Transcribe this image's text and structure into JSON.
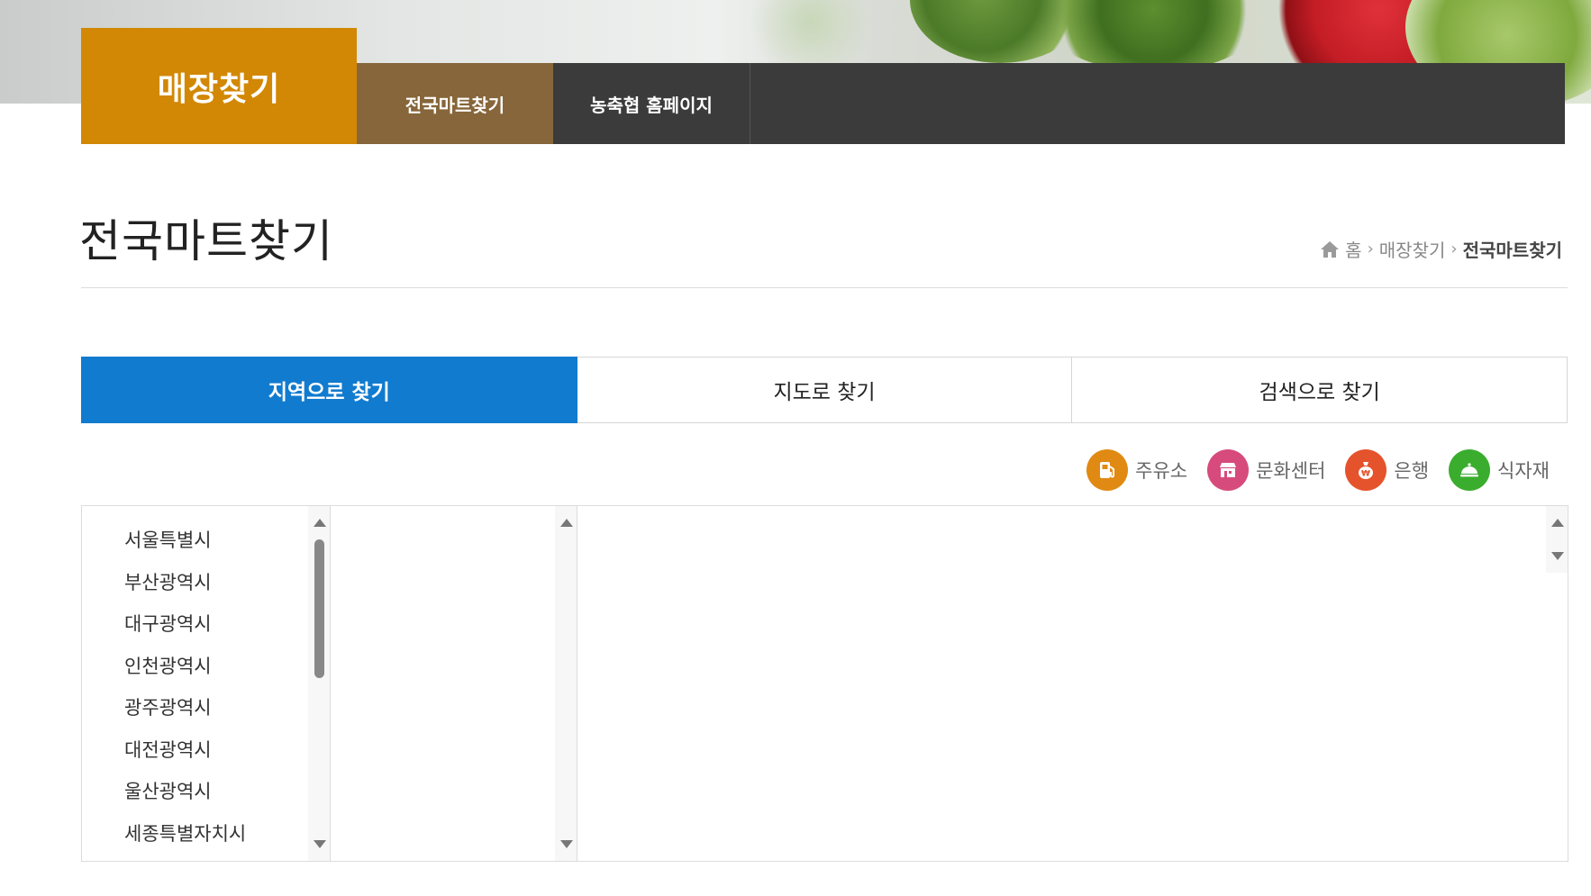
{
  "brand": {
    "title": "매장찾기",
    "color": "#d28805"
  },
  "nav": {
    "items": [
      {
        "label": "전국마트찾기",
        "active": true
      },
      {
        "label": "농축협 홈페이지",
        "active": false
      }
    ],
    "active_color": "#86663a",
    "bar_color": "#3b3b3b"
  },
  "page": {
    "title": "전국마트찾기",
    "breadcrumb": [
      "홈",
      "매장찾기",
      "전국마트찾기"
    ]
  },
  "tabs": [
    {
      "label": "지역으로 찾기",
      "active": true
    },
    {
      "label": "지도로 찾기",
      "active": false
    },
    {
      "label": "검색으로 찾기",
      "active": false
    }
  ],
  "tab_active_color": "#117bcf",
  "legend": [
    {
      "label": "주유소",
      "icon": "gas-station-icon",
      "color": "#e08a13"
    },
    {
      "label": "문화센터",
      "icon": "store-icon",
      "color": "#d64b7c"
    },
    {
      "label": "은행",
      "icon": "money-bag-icon",
      "color": "#e5532c"
    },
    {
      "label": "식자재",
      "icon": "food-dome-icon",
      "color": "#3aad2e"
    }
  ],
  "regions": [
    "서울특별시",
    "부산광역시",
    "대구광역시",
    "인천광역시",
    "광주광역시",
    "대전광역시",
    "울산광역시",
    "세종특별자치시"
  ]
}
